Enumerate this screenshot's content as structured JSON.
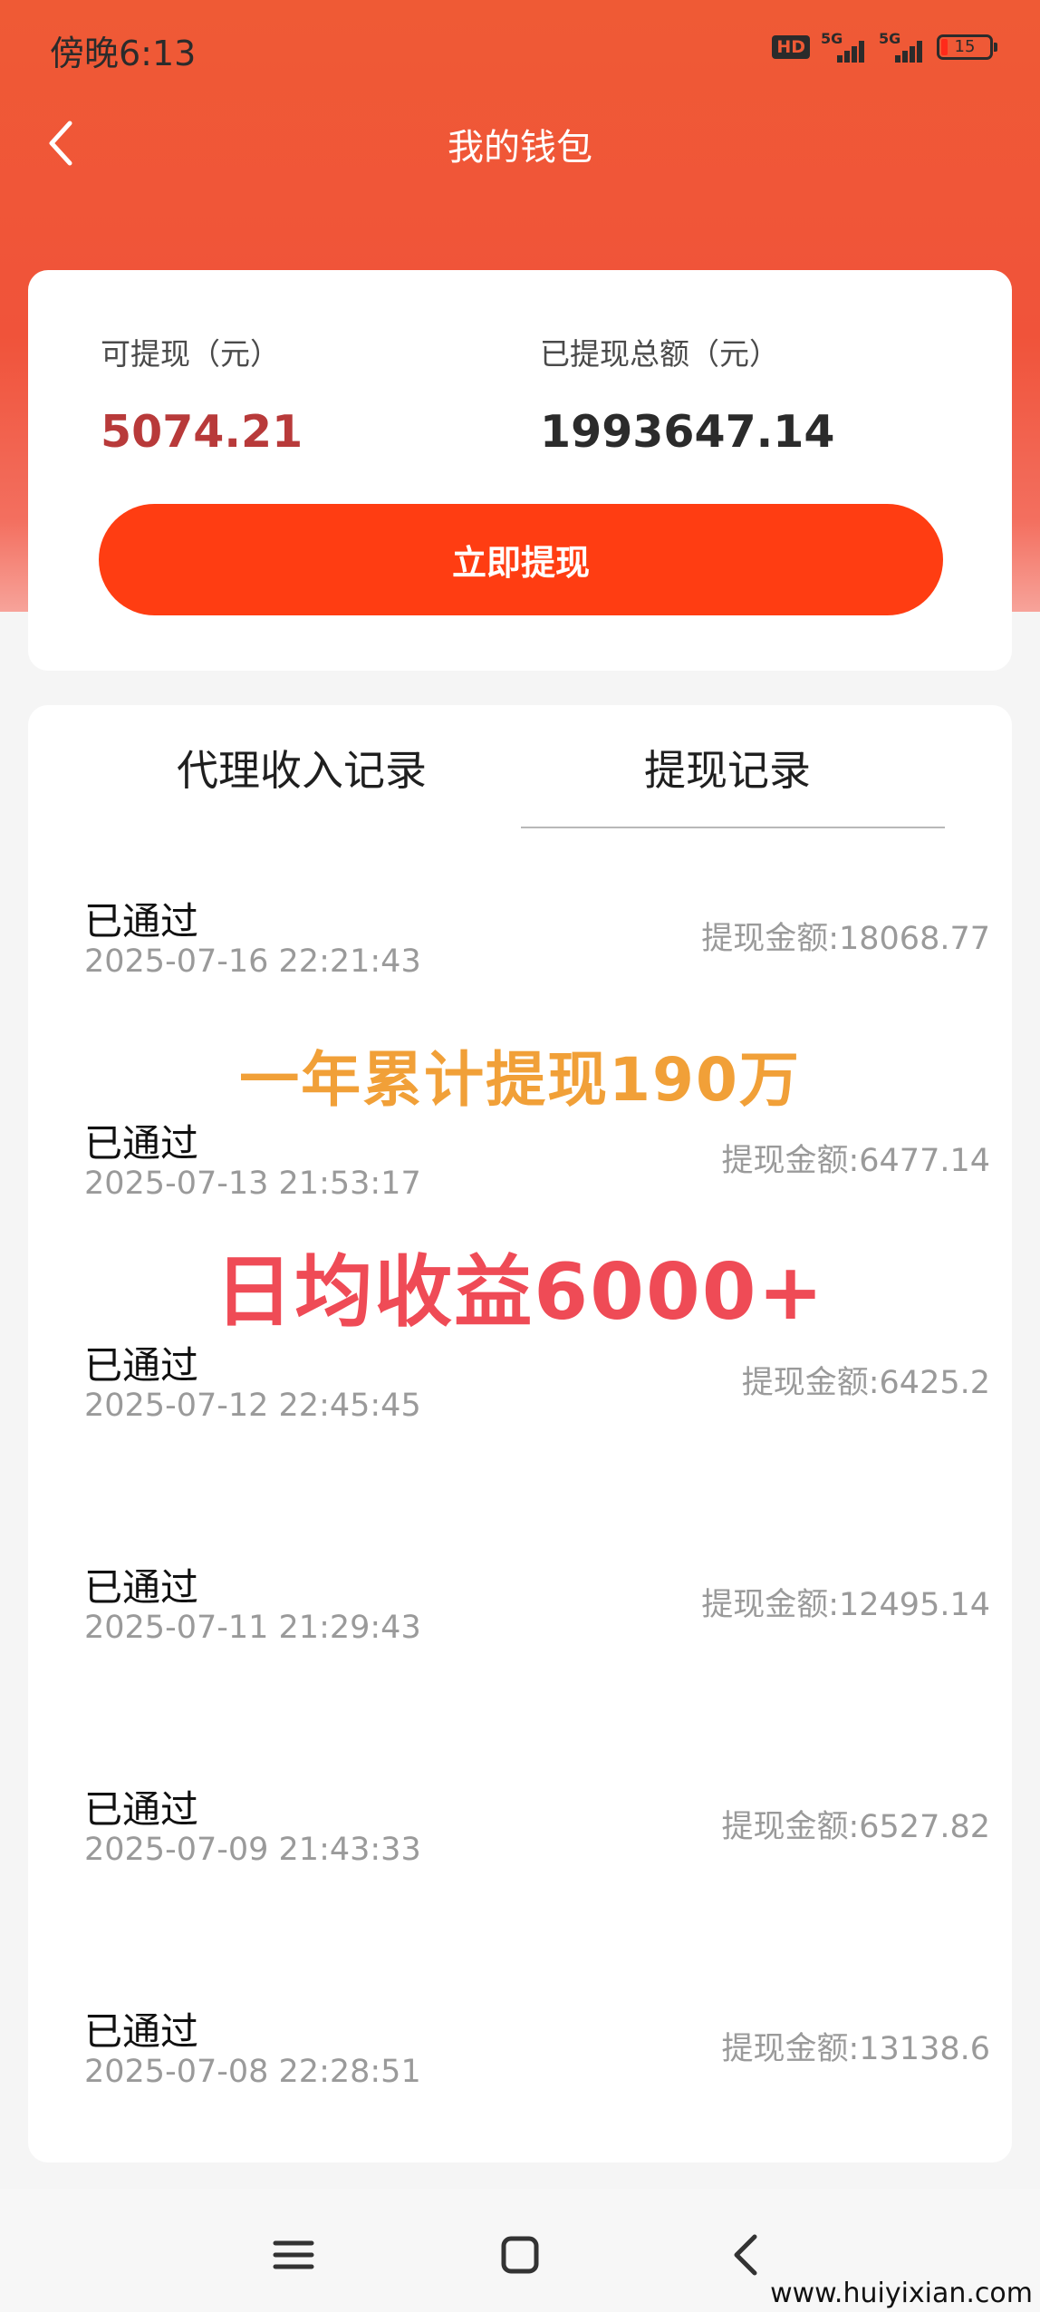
{
  "status_bar": {
    "time": "傍晚6:13",
    "hd": "HD",
    "network1": "5G",
    "network2": "5G",
    "battery": "15",
    "colors": {
      "text": "#2b2b2b",
      "battery_low": "#ff2a1a"
    }
  },
  "header": {
    "title": "我的钱包",
    "back_icon": "chevron-left-icon"
  },
  "balance": {
    "available_label": "可提现（元）",
    "available_value": "5074.21",
    "total_label": "已提现总额（元）",
    "total_value": "1993647.14",
    "withdraw_button": "立即提现",
    "colors": {
      "available_value": "#b83a3a",
      "button": "#ff3d12",
      "hero": "#ef5a35"
    }
  },
  "tabs": [
    {
      "label": "代理收入记录",
      "active": false
    },
    {
      "label": "提现记录",
      "active": true
    }
  ],
  "records": [
    {
      "status": "已通过",
      "datetime": "2025-07-16 22:21:43",
      "amount": "提现金额:18068.77"
    },
    {
      "status": "已通过",
      "datetime": "2025-07-13 21:53:17",
      "amount": "提现金额:6477.14"
    },
    {
      "status": "已通过",
      "datetime": "2025-07-12 22:45:45",
      "amount": "提现金额:6425.2"
    },
    {
      "status": "已通过",
      "datetime": "2025-07-11 21:29:43",
      "amount": "提现金额:12495.14"
    },
    {
      "status": "已通过",
      "datetime": "2025-07-09 21:43:33",
      "amount": "提现金额:6527.82"
    },
    {
      "status": "已通过",
      "datetime": "2025-07-08 22:28:51",
      "amount": "提现金额:13138.6"
    }
  ],
  "overlay": {
    "line1": "一年累计提现190万",
    "line2": "日均收益6000+",
    "colors": {
      "line1": "#f1a038",
      "line2": "#ef4b56"
    }
  },
  "nav_bar": {
    "icons": [
      "menu-icon",
      "home-square-icon",
      "back-icon"
    ]
  },
  "watermark": "www.huiyixian.com"
}
